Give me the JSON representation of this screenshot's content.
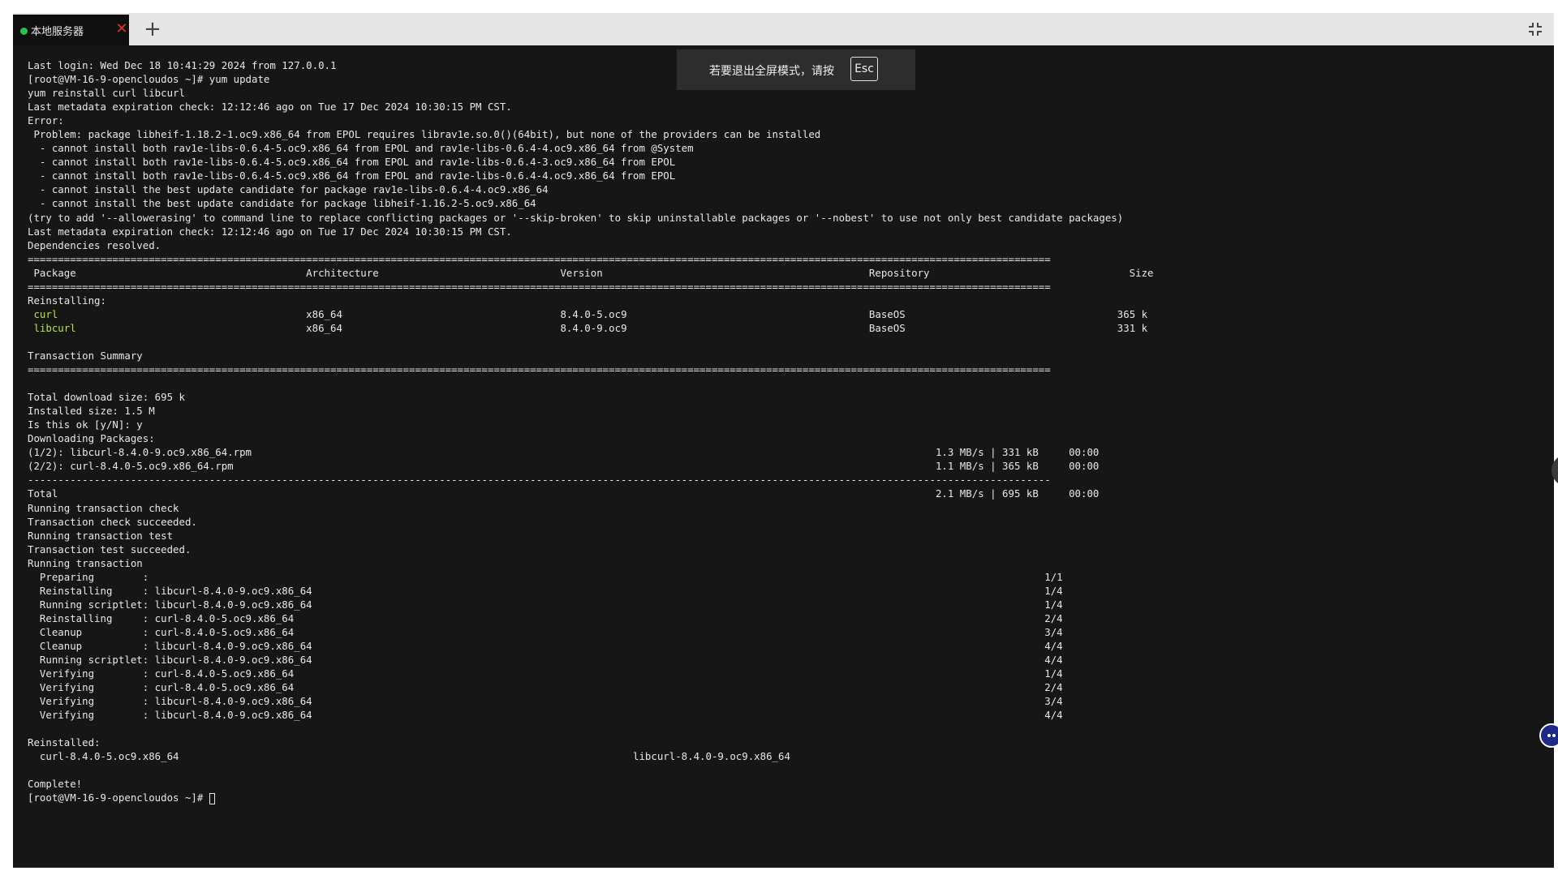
{
  "tab": {
    "title": "本地服务器",
    "status_color": "#27c24c",
    "close_icon": "close-icon",
    "close_color": "#e03131"
  },
  "add_tab": {
    "icon": "plus-icon"
  },
  "exit_fullscreen": {
    "icon": "exit-fullscreen-icon"
  },
  "fullscreen_toast": {
    "message": "若要退出全屏模式，请按",
    "key": "Esc"
  },
  "terminal": {
    "prompt": "[root@VM-16-9-opencloudos ~]# ",
    "lines": [
      "Last login: Wed Dec 18 10:41:29 2024 from 127.0.0.1",
      "[root@VM-16-9-opencloudos ~]# yum update",
      "yum reinstall curl libcurl",
      "Last metadata expiration check: 12:12:46 ago on Tue 17 Dec 2024 10:30:15 PM CST.",
      "Error:",
      " Problem: package libheif-1.18.2-1.oc9.x86_64 from EPOL requires librav1e.so.0()(64bit), but none of the providers can be installed",
      "  - cannot install both rav1e-libs-0.6.4-5.oc9.x86_64 from EPOL and rav1e-libs-0.6.4-4.oc9.x86_64 from @System",
      "  - cannot install both rav1e-libs-0.6.4-5.oc9.x86_64 from EPOL and rav1e-libs-0.6.4-3.oc9.x86_64 from EPOL",
      "  - cannot install both rav1e-libs-0.6.4-5.oc9.x86_64 from EPOL and rav1e-libs-0.6.4-4.oc9.x86_64 from EPOL",
      "  - cannot install the best update candidate for package rav1e-libs-0.6.4-4.oc9.x86_64",
      "  - cannot install the best update candidate for package libheif-1.16.2-5.oc9.x86_64",
      "(try to add '--allowerasing' to command line to replace conflicting packages or '--skip-broken' to skip uninstallable packages or '--nobest' to use not only best candidate packages)",
      "Last metadata expiration check: 12:12:46 ago on Tue 17 Dec 2024 10:30:15 PM CST.",
      "Dependencies resolved.",
      "=========================================================================================================================================================================",
      " Package                                      Architecture                              Version                                            Repository                                 Size",
      "=========================================================================================================================================================================",
      "Reinstalling:",
      " curl                                         x86_64                                    8.4.0-5.oc9                                        BaseOS                                   365 k",
      " libcurl                                      x86_64                                    8.4.0-9.oc9                                        BaseOS                                   331 k",
      "",
      "Transaction Summary",
      "=========================================================================================================================================================================",
      "",
      "Total download size: 695 k",
      "Installed size: 1.5 M",
      "Is this ok [y/N]: y",
      "Downloading Packages:",
      "(1/2): libcurl-8.4.0-9.oc9.x86_64.rpm                                                                                                                 1.3 MB/s | 331 kB     00:00",
      "(2/2): curl-8.4.0-5.oc9.x86_64.rpm                                                                                                                    1.1 MB/s | 365 kB     00:00",
      "-------------------------------------------------------------------------------------------------------------------------------------------------------------------------",
      "Total                                                                                                                                                 2.1 MB/s | 695 kB     00:00",
      "Running transaction check",
      "Transaction check succeeded.",
      "Running transaction test",
      "Transaction test succeeded.",
      "Running transaction",
      "  Preparing        :                                                                                                                                                    1/1",
      "  Reinstalling     : libcurl-8.4.0-9.oc9.x86_64                                                                                                                         1/4",
      "  Running scriptlet: libcurl-8.4.0-9.oc9.x86_64                                                                                                                         1/4",
      "  Reinstalling     : curl-8.4.0-5.oc9.x86_64                                                                                                                            2/4",
      "  Cleanup          : curl-8.4.0-5.oc9.x86_64                                                                                                                            3/4",
      "  Cleanup          : libcurl-8.4.0-9.oc9.x86_64                                                                                                                         4/4",
      "  Running scriptlet: libcurl-8.4.0-9.oc9.x86_64                                                                                                                         4/4",
      "  Verifying        : curl-8.4.0-5.oc9.x86_64                                                                                                                            1/4",
      "  Verifying        : curl-8.4.0-5.oc9.x86_64                                                                                                                            2/4",
      "  Verifying        : libcurl-8.4.0-9.oc9.x86_64                                                                                                                         3/4",
      "  Verifying        : libcurl-8.4.0-9.oc9.x86_64                                                                                                                         4/4",
      "",
      "Reinstalled:",
      "  curl-8.4.0-5.oc9.x86_64                                                                           libcurl-8.4.0-9.oc9.x86_64",
      "",
      "Complete!"
    ],
    "highlight_color": "#b8e63c",
    "highlighted_packages": [
      "curl",
      "libcurl"
    ]
  },
  "side_handle": {
    "icon": "chevron-left-icon"
  },
  "assistant": {
    "icon": "assistant-icon",
    "color": "#1e2a8a"
  }
}
